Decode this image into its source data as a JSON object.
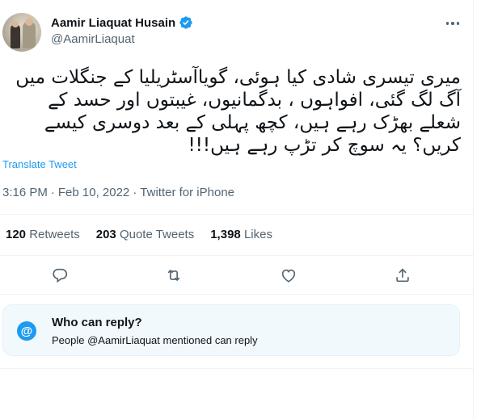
{
  "author": {
    "name": "Aamir Liaquat Husain",
    "handle": "@AamirLiaquat",
    "verified": true
  },
  "tweet": {
    "lines": [
      "میری تیسری شادی کیا ہوئی، گویاآسٹریلیا کے جنگلات میں",
      "آگ لگ گئی، افواہوں ، بدگمانیوں، غیبتوں اور حسد کے",
      "شعلے بھڑک رہے ہیں، کچھ پہلی کے بعد دوسری کیسے",
      "کریں؟ یہ سوچ کر تڑپ رہے ہیں!!!"
    ],
    "translate_label": "Translate Tweet",
    "time": "3:16 PM",
    "separator": "·",
    "date": "Feb 10, 2022",
    "source": "Twitter for iPhone"
  },
  "stats": {
    "retweets_count": "120",
    "retweets_label": "Retweets",
    "quotes_count": "203",
    "quotes_label": "Quote Tweets",
    "likes_count": "1,398",
    "likes_label": "Likes"
  },
  "actions": {
    "icons": [
      "reply-icon",
      "retweet-icon",
      "like-icon",
      "share-icon"
    ]
  },
  "reply_settings": {
    "icon": "@",
    "title": "Who can reply?",
    "subtitle": "People @AamirLiaquat mentioned can reply"
  },
  "colors": {
    "accent": "#1d9bf0",
    "text": "#0f1419",
    "muted": "#536471",
    "reply_box_bg": "#f2f9fd"
  }
}
